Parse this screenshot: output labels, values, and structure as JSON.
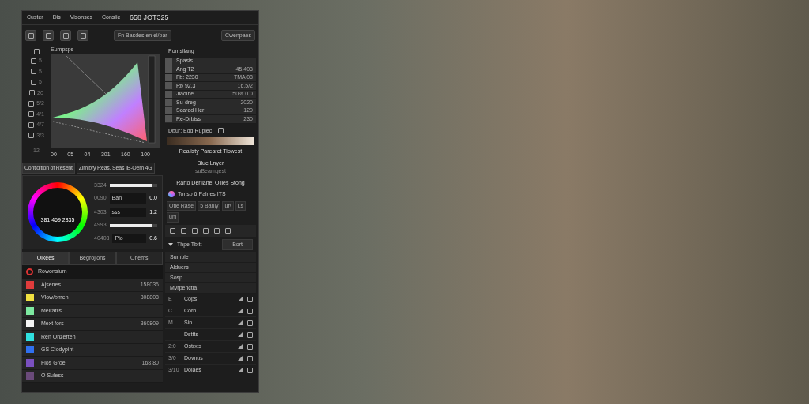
{
  "menu": [
    "Custer",
    "Dis",
    "Visonses",
    "Conslic"
  ],
  "window": {
    "title": "658 JOT325"
  },
  "toolbar": {
    "center_button": "Fn Basdes en ei/par",
    "right_button": "Cwenpaes"
  },
  "tool_column": {
    "labels": [
      "5",
      "5",
      "5",
      "20",
      "5/2",
      "4/1",
      "4/7",
      "3/3"
    ],
    "bottom_label": "12"
  },
  "gamut": {
    "title": "Eumpsps",
    "axis_labels": [
      "00",
      "05",
      "04",
      "301",
      "160",
      "100"
    ]
  },
  "view_tabs": [
    {
      "label": "Contidition of Resent",
      "selected": true
    },
    {
      "label": "Zimibry Reas, Seas IB-Oem 4G",
      "selected": false
    }
  ],
  "wheel": {
    "value": "381 469 2835"
  },
  "adjustments": [
    {
      "kind": "slider",
      "label": "3324",
      "level": 0.9
    },
    {
      "kind": "field",
      "label": "0090",
      "value": "Ban",
      "reading": "0.0"
    },
    {
      "kind": "field",
      "label": "4303",
      "value": "sss",
      "reading": "1.2"
    },
    {
      "kind": "slider",
      "label": "4993",
      "level": 0.9
    },
    {
      "kind": "field",
      "label": "40403",
      "value": "Pio",
      "reading": "0.6"
    }
  ],
  "list_tabs": [
    {
      "label": "Olkees",
      "selected": true
    },
    {
      "label": "Begrojions",
      "selected": false
    },
    {
      "label": "Ohems",
      "selected": false
    }
  ],
  "list_header": "Rowonsium",
  "swatches": [
    {
      "name": "Ajsenes",
      "color": "#e03c3c",
      "value": "158036"
    },
    {
      "name": "Vlow/bmen",
      "color": "#f0e040",
      "value": "308808"
    },
    {
      "name": "Meirafils",
      "color": "#7de8a0"
    },
    {
      "name": "Mext fors",
      "color": "#f4f4f4",
      "value": "360809"
    },
    {
      "name": "Ren Onzerten",
      "color": "#30e0e0"
    },
    {
      "name": "GS Clodypint",
      "color": "#3070f0"
    },
    {
      "name": "Flos Grde",
      "color": "#7a50c0",
      "value": "168.80"
    },
    {
      "name": "O Suless",
      "color": "#6a4a7a"
    }
  ],
  "properties": {
    "title": "Pomsilang",
    "rows": [
      {
        "label": "Spasis"
      },
      {
        "label": "Ang T2",
        "value": "45.403"
      },
      {
        "label": "Fb: 2230",
        "value": "TMA 08"
      },
      {
        "label": "Rb 92.3",
        "value": "16.5/2"
      },
      {
        "label": "Jiadine",
        "value": "50% 0.0"
      },
      {
        "label": "Su-dreg",
        "value": "2020"
      },
      {
        "label": "Scared Her",
        "value": "120"
      },
      {
        "label": "Re-Drbiss",
        "value": "230"
      }
    ],
    "blur_label": "Dbur: Edd Ruplec",
    "gradient_caption": "Realisty Parearet Tiowest",
    "layer_name": "Blue Lnyer",
    "layer_sub": "suBeamgest"
  },
  "presets": {
    "title": "Rarto Derlianel Ollies Stong",
    "source": "Tonsb 6 Palnes ITS",
    "fields": [
      "Otle Rase",
      "5 Baniy",
      "ur\\",
      "Ls",
      "unl"
    ]
  },
  "section": {
    "title": "Thpe Tbitt",
    "expanded": true,
    "button": "Bort",
    "rows": [
      "Sumble",
      "Alduers",
      "Sosp",
      "Mvrpenctla"
    ]
  },
  "grid_rows": [
    {
      "prefix": "E",
      "label": "Cops"
    },
    {
      "prefix": "C",
      "label": "Corn"
    },
    {
      "prefix": "M",
      "label": "Sin"
    },
    {
      "prefix": "",
      "label": "Dsttts"
    },
    {
      "prefix": "2:0",
      "label": "Ostrxts"
    },
    {
      "prefix": "3/0",
      "label": "Dovnus"
    },
    {
      "prefix": "3/10",
      "label": "Dolaes"
    }
  ]
}
